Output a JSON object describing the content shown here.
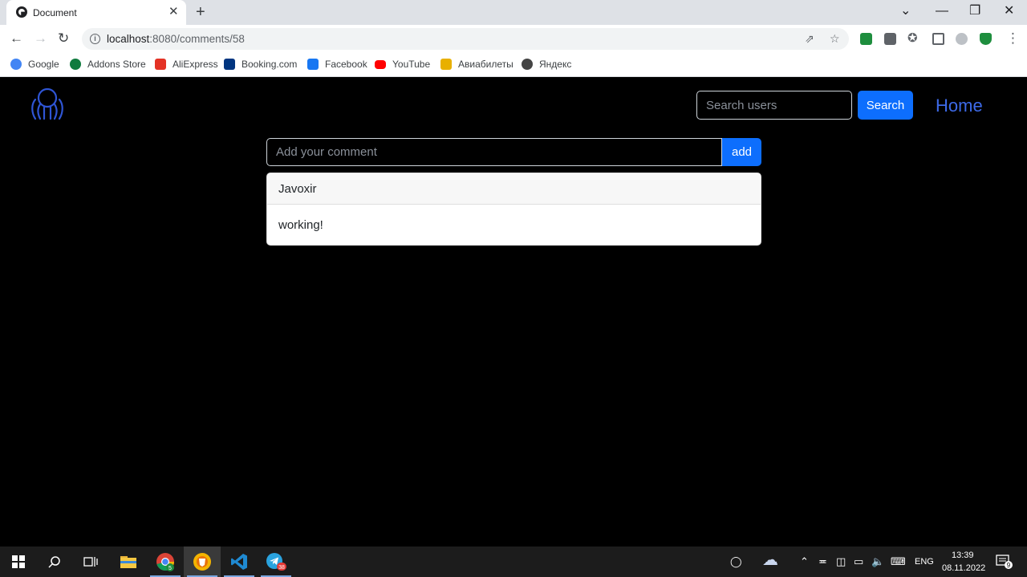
{
  "browser": {
    "tab_title": "Document",
    "tab_close": "✕",
    "new_tab": "+",
    "window_controls": {
      "minimize": "—",
      "restore": "❐",
      "close": "✕",
      "tab_search": "⌄"
    },
    "url_host": "localhost",
    "url_rest": ":8080/comments/58",
    "bookmarks": [
      {
        "label": "Google",
        "color": "#4285f4"
      },
      {
        "label": "Addons Store",
        "color": "#0f7b3e"
      },
      {
        "label": "AliExpress",
        "color": "#e43225"
      },
      {
        "label": "Booking.com",
        "color": "#003580"
      },
      {
        "label": "Facebook",
        "color": "#1877f2"
      },
      {
        "label": "YouTube",
        "color": "#ff0000"
      },
      {
        "label": "Авиабилеты",
        "color": "#e8b000"
      },
      {
        "label": "Яндекс",
        "color": "#444444"
      }
    ]
  },
  "header": {
    "search_placeholder": "Search users",
    "search_button": "Search",
    "home_link": "Home",
    "logo_icon": "hands-circle-icon"
  },
  "comment_form": {
    "placeholder": "Add your comment",
    "submit_label": "add"
  },
  "comments": [
    {
      "author": "Javoxir",
      "text": "working!"
    }
  ],
  "taskbar": {
    "time": "13:39",
    "date": "08.11.2022",
    "language": "ENG",
    "notification_count": "9",
    "chrome_badge": "5",
    "telegram_badge": "38"
  },
  "colors": {
    "accent": "#0d6efd",
    "home_link": "#3d6ae8",
    "background": "#000000"
  }
}
